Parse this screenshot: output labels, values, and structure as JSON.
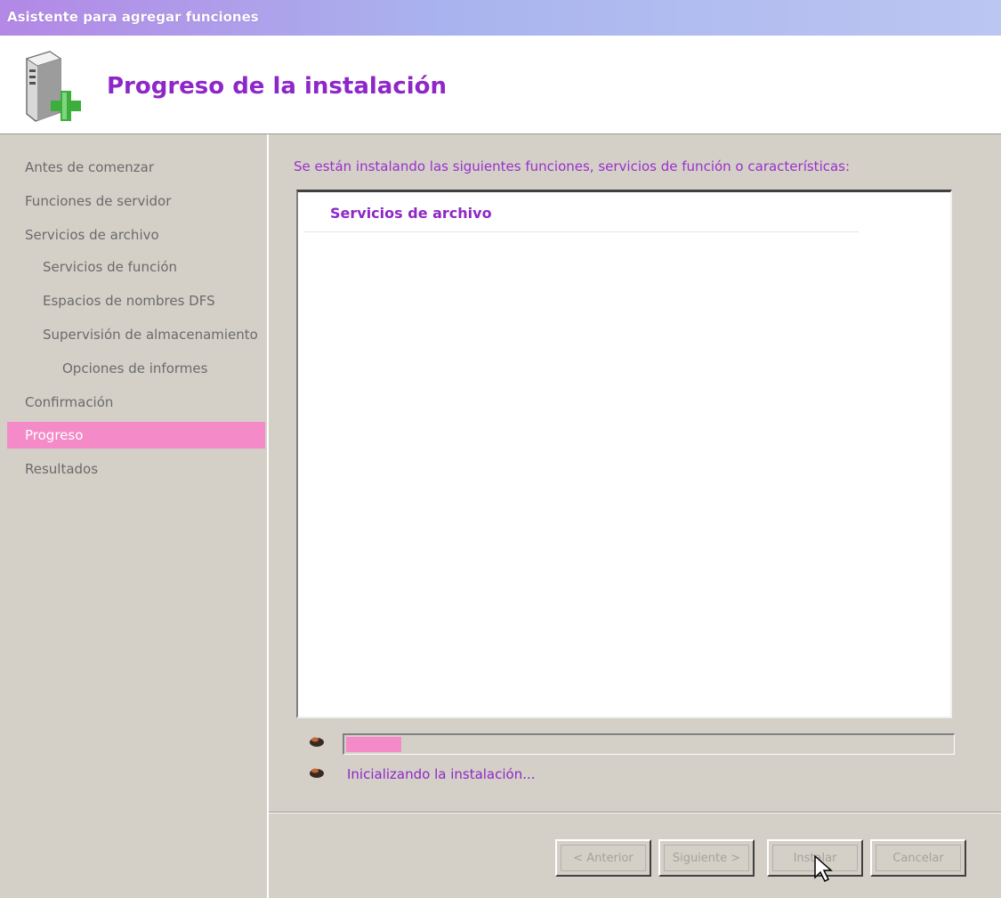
{
  "window": {
    "title": "Asistente para agregar funciones"
  },
  "header": {
    "title": "Progreso de la instalación",
    "icon": "server-add-icon"
  },
  "nav": {
    "items": [
      {
        "label": "Antes de comenzar",
        "level": 1,
        "active": false
      },
      {
        "label": "Funciones de servidor",
        "level": 1,
        "active": false
      },
      {
        "label": "Servicios de archivo",
        "level": 1,
        "active": false
      },
      {
        "label": "Servicios de función",
        "level": 2,
        "active": false
      },
      {
        "label": "Espacios de nombres DFS",
        "level": 2,
        "active": false
      },
      {
        "label": "Supervisión de almacenamiento",
        "level": 2,
        "active": false
      },
      {
        "label": "Opciones de informes",
        "level": 3,
        "active": false
      },
      {
        "label": "Confirmación",
        "level": 1,
        "active": false
      },
      {
        "label": "Progreso",
        "level": 1,
        "active": true
      },
      {
        "label": "Resultados",
        "level": 1,
        "active": false
      }
    ]
  },
  "main": {
    "heading": "Se están instalando las siguientes funciones, servicios de función o características:",
    "list_items": [
      "Servicios de archivo"
    ],
    "progress": 0.09,
    "status_text": "Inicializando la instalación..."
  },
  "buttons": {
    "back": "< Anterior",
    "next": "Siguiente >",
    "install": "Instalar",
    "cancel": "Cancelar"
  },
  "colors": {
    "accent": "#8e27c8",
    "highlight": "#f48bc8",
    "dialog_bg": "#d4d0c8"
  }
}
